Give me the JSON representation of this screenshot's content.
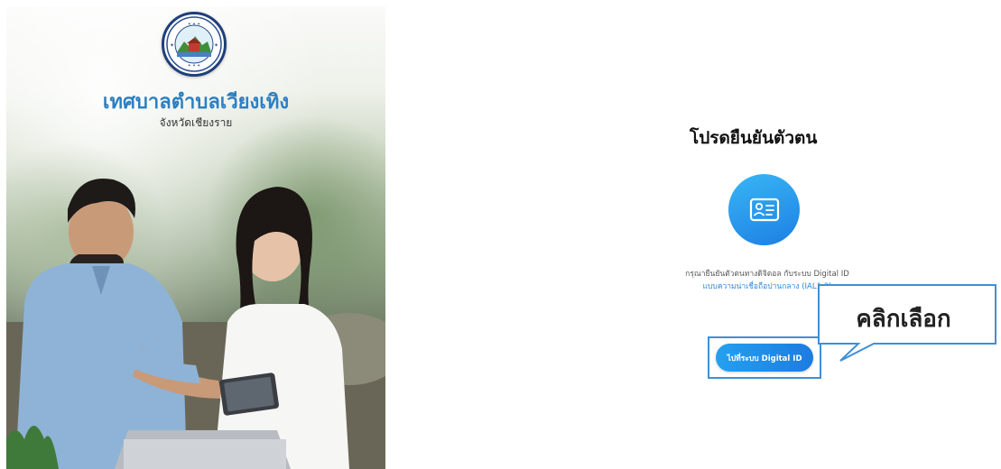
{
  "brand": {
    "organization": "เทศบาลตำบลเวียงเทิง",
    "province": "จังหวัดเชียงราย",
    "seal_icon": "municipality-seal-icon"
  },
  "verification": {
    "title": "โปรดยืนยันตัวตน",
    "icon": "id-card-icon",
    "description_line1": "กรุณายืนยันตัวตนทางดิจิตอล กับระบบ Digital ID",
    "description_line2": "แบบความน่าเชื่อถือปานกลาง (IAL1.3)",
    "button_label": "ไปที่ระบบ Digital ID"
  },
  "annotation": {
    "callout_text": "คลิกเลือก"
  },
  "colors": {
    "brand_blue": "#2c7fc1",
    "button_blue": "#1c7ce0",
    "highlight_border": "#3f8fd6"
  }
}
